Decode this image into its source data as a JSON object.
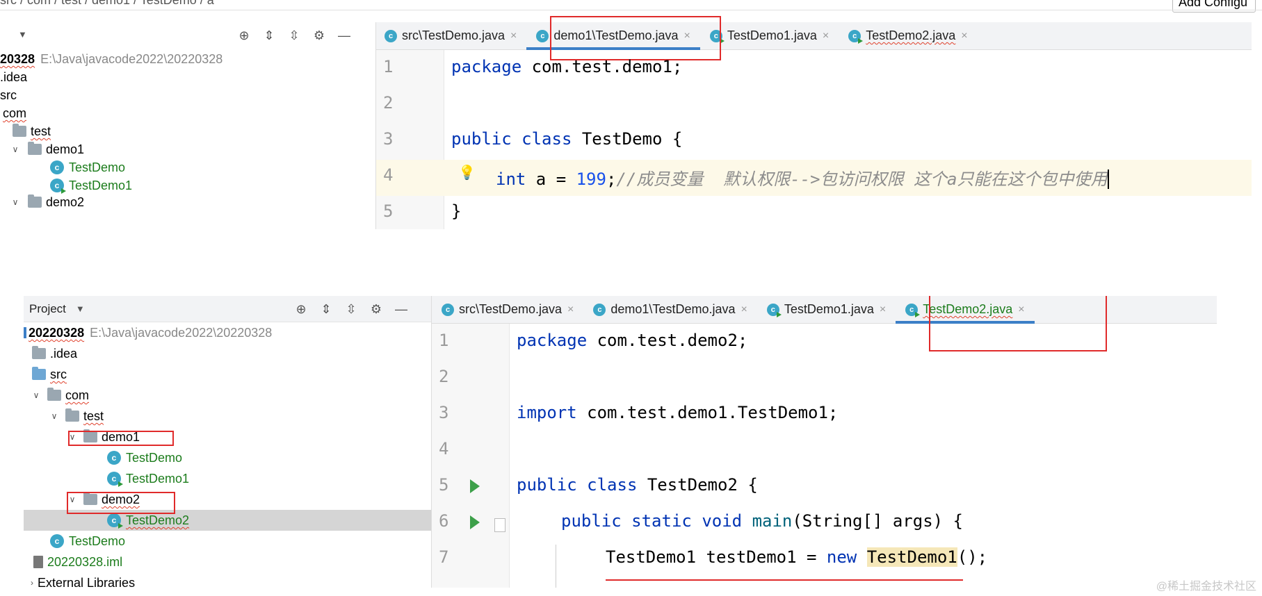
{
  "top": {
    "breadcrumb": "src / com / test / demo1 / TestDemo / a",
    "add_config": "Add Configu",
    "project": {
      "root_name": "20328",
      "root_path": "E:\\Java\\javacode2022\\20220328",
      "items": [
        ".idea",
        "src",
        "com",
        "test",
        "demo1",
        "TestDemo",
        "TestDemo1",
        "demo2"
      ]
    },
    "tabs": [
      "src\\TestDemo.java",
      "demo1\\TestDemo.java",
      "TestDemo1.java",
      "TestDemo2.java"
    ],
    "line_numbers": [
      "1",
      "2",
      "3",
      "4",
      "5"
    ],
    "code": {
      "l1_kw": "package",
      "l1_rest": " com.test.demo1;",
      "l3_kw1": "public",
      "l3_kw2": "class",
      "l3_rest": " TestDemo {",
      "l4_kw": "int",
      "l4_mid": " a = ",
      "l4_num": "199",
      "l4_semi": ";",
      "l4_comment": "//成员变量  默认权限-->包访问权限 这个a只能在这个包中使用",
      "l5": "}"
    }
  },
  "bottom": {
    "project_label": "Project",
    "project": {
      "root_name": "20220328",
      "root_path": "E:\\Java\\javacode2022\\20220328",
      "items": [
        ".idea",
        "src",
        "com",
        "test",
        "demo1",
        "TestDemo",
        "TestDemo1",
        "demo2",
        "TestDemo2",
        "TestDemo",
        "20220328.iml",
        "External Libraries"
      ]
    },
    "tabs": [
      "src\\TestDemo.java",
      "demo1\\TestDemo.java",
      "TestDemo1.java",
      "TestDemo2.java"
    ],
    "line_numbers": [
      "1",
      "2",
      "3",
      "4",
      "5",
      "6",
      "7"
    ],
    "code": {
      "l1_kw": "package",
      "l1_rest": " com.test.demo2;",
      "l3_kw": "import",
      "l3_rest": " com.test.demo1.TestDemo1;",
      "l5_kw1": "public",
      "l5_kw2": "class",
      "l5_rest": " TestDemo2 {",
      "l6_kw1": "public",
      "l6_kw2": "static",
      "l6_kw3": "void",
      "l6_fn": "main",
      "l6_rest": "(String[] args) {",
      "l7_a": "TestDemo1 testDemo1 = ",
      "l7_kw": "new",
      "l7_sp": " ",
      "l7_hl": "TestDemo1",
      "l7_end": "();"
    }
  },
  "watermark": "@稀土掘金技术社区",
  "colors": {
    "keyword": "#0033b3",
    "number": "#1750eb",
    "comment": "#8c8c8c",
    "class_green": "#1c7c1c",
    "red_box": "#e02a2a",
    "tab_active": "#3c7fc7"
  }
}
